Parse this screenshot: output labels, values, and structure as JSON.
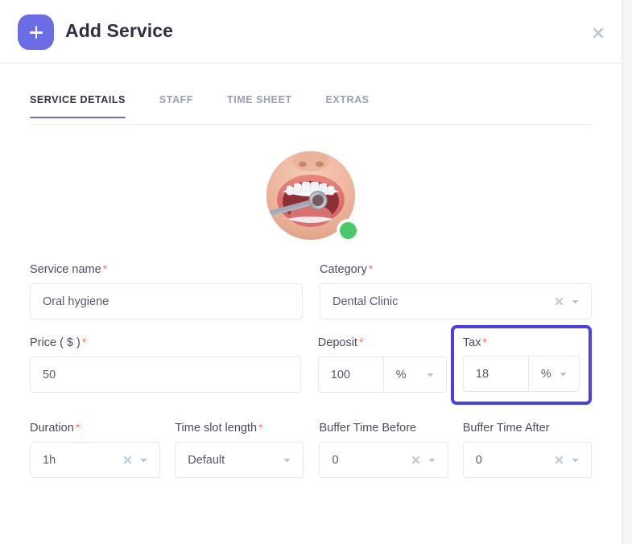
{
  "header": {
    "title": "Add Service",
    "add_icon": "plus-icon",
    "close_icon": "close-icon",
    "accent_color": "#6c6ce5"
  },
  "tabs": [
    {
      "label": "SERVICE DETAILS",
      "active": true
    },
    {
      "label": "STAFF",
      "active": false
    },
    {
      "label": "TIME SHEET",
      "active": false
    },
    {
      "label": "EXTRAS",
      "active": false
    }
  ],
  "avatar": {
    "name": "service-image",
    "alt": "dental-exam-photo",
    "status_color": "#4ac86a",
    "status_label": "active"
  },
  "form": {
    "service_name": {
      "label": "Service name",
      "required": "*",
      "value": "Oral hygiene"
    },
    "category": {
      "label": "Category",
      "required": "*",
      "value": "Dental Clinic",
      "clear_icon": "clear-icon",
      "caret_icon": "chevron-down-icon"
    },
    "price": {
      "label": "Price ( $ )",
      "required": "*",
      "value": "50"
    },
    "deposit": {
      "label": "Deposit",
      "required": "*",
      "value": "100",
      "unit": "%",
      "caret_icon": "chevron-down-icon"
    },
    "tax": {
      "label": "Tax",
      "required": "*",
      "value": "18",
      "unit": "%",
      "caret_icon": "chevron-down-icon",
      "highlight_color": "#4a3ee8"
    },
    "duration": {
      "label": "Duration",
      "required": "*",
      "value": "1h",
      "clear_icon": "clear-icon",
      "caret_icon": "chevron-down-icon"
    },
    "time_slot_length": {
      "label": "Time slot length",
      "required": "*",
      "value": "Default",
      "caret_icon": "chevron-down-icon"
    },
    "buffer_before": {
      "label": "Buffer Time Before",
      "required": "",
      "value": "0",
      "clear_icon": "clear-icon",
      "caret_icon": "chevron-down-icon"
    },
    "buffer_after": {
      "label": "Buffer Time After",
      "required": "",
      "value": "0",
      "clear_icon": "clear-icon",
      "caret_icon": "chevron-down-icon"
    }
  }
}
